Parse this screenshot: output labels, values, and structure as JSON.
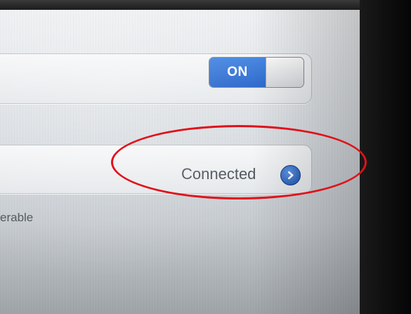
{
  "bluetooth": {
    "toggle_label": "ON"
  },
  "device_row": {
    "status": "Connected",
    "detail_icon": "chevron-right-circle-icon"
  },
  "footer": {
    "text": "erable"
  },
  "colors": {
    "accent": "#2f6fd6",
    "annotation": "#e0121a"
  }
}
